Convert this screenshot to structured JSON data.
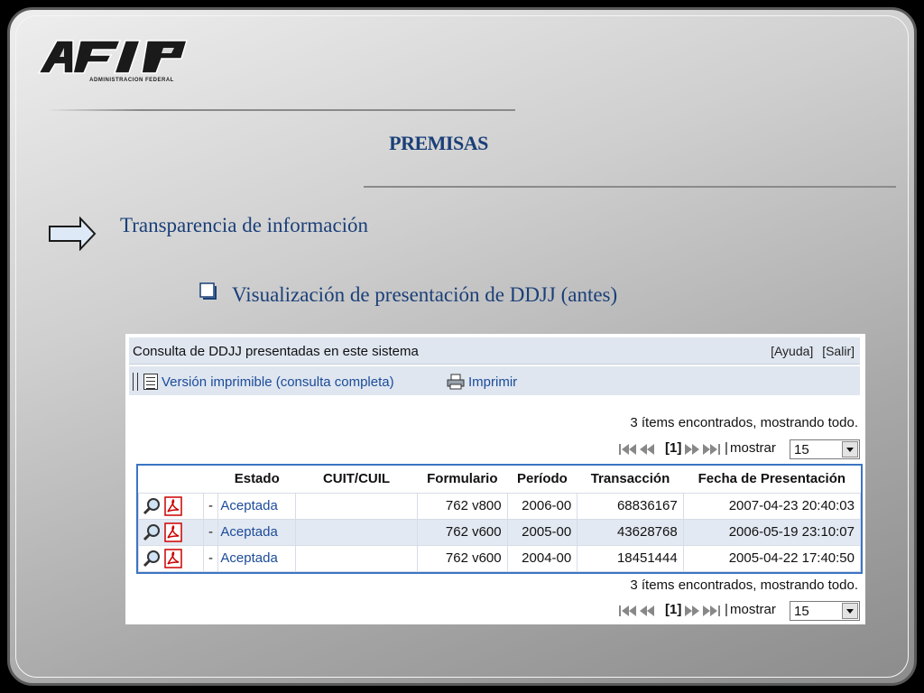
{
  "slide": {
    "logo_sub": "ADMINISTRACION FEDERAL",
    "title": "PREMISAS",
    "bullet_1": "Transparencia de información",
    "bullet_2": "Visualización de presentación de DDJJ (antes)"
  },
  "panel": {
    "title": "Consulta de DDJJ presentadas en este sistema",
    "links": {
      "help": "[Ayuda]",
      "exit": "[Salir]"
    },
    "toolbar": {
      "printable_version": "Versión imprimible (consulta completa)",
      "print": "Imprimir"
    },
    "status": "3 ítems encontrados, mostrando todo.",
    "pager": {
      "current": "[1]",
      "separator": "|",
      "show_label": "mostrar",
      "show_value": "15"
    },
    "table": {
      "headers": [
        "",
        "",
        "Estado",
        "CUIT/CUIL",
        "Formulario",
        "Período",
        "Transacción",
        "Fecha de Presentación"
      ],
      "rows": [
        {
          "dash": "-",
          "estado": "Aceptada",
          "cuit": "",
          "formulario": "762 v800",
          "periodo": "2006-00",
          "transaccion": "68836167",
          "fecha": "2007-04-23 20:40:03"
        },
        {
          "dash": "-",
          "estado": "Aceptada",
          "cuit": "",
          "formulario": "762 v600",
          "periodo": "2005-00",
          "transaccion": "43628768",
          "fecha": "2006-05-19 23:10:07"
        },
        {
          "dash": "-",
          "estado": "Aceptada",
          "cuit": "",
          "formulario": "762 v600",
          "periodo": "2004-00",
          "transaccion": "18451444",
          "fecha": "2005-04-22 17:40:50"
        }
      ]
    }
  },
  "colors": {
    "title_blue": "#1a3f78",
    "link_blue": "#1b4b9a",
    "table_border": "#3b74c4",
    "row_alt": "#e3e9f2"
  }
}
